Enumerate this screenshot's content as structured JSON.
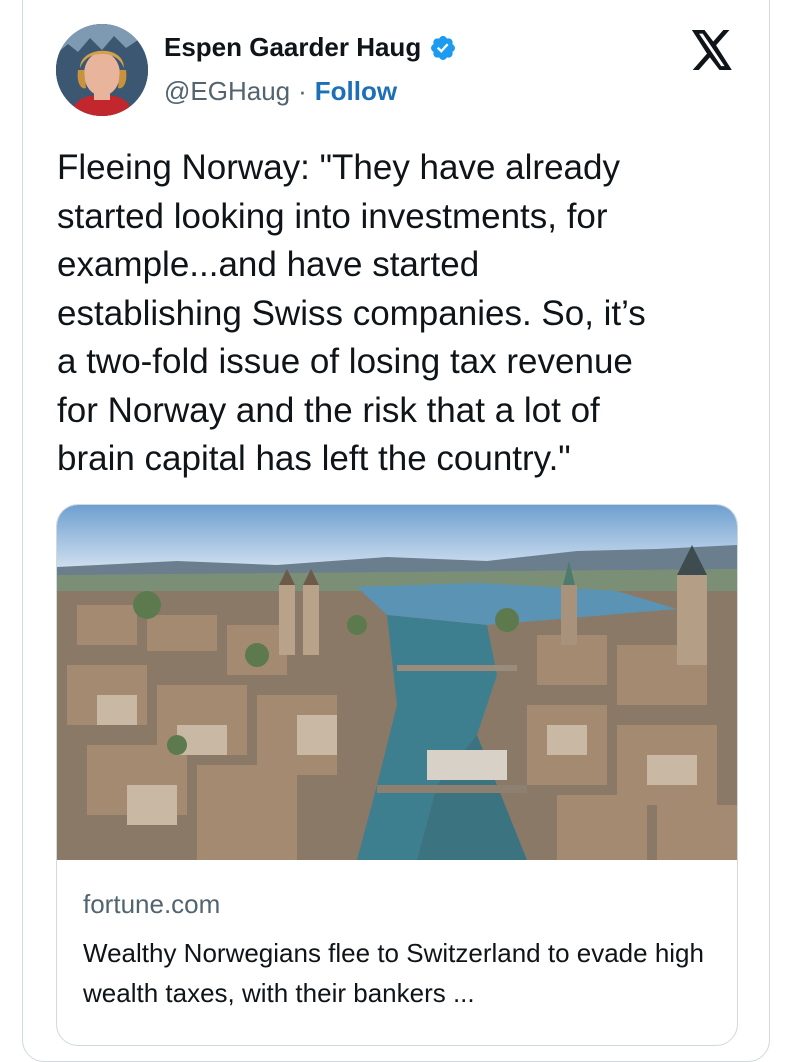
{
  "author": {
    "name": "Espen Gaarder Haug",
    "handle": "@EGHaug",
    "separator": "·",
    "follow_label": "Follow",
    "verified": true
  },
  "tweet": {
    "text": "Fleeing Norway: \"They have already\nstarted looking into investments, for\nexample...and have started\nestablishing Swiss companies. So, it’s\na two-fold issue of losing tax revenue\nfor Norway and the risk that a lot of\nbrain capital has left the country.\""
  },
  "link_card": {
    "domain": "fortune.com",
    "headline": "Wealthy Norwegians flee to Switzerland to evade high wealth taxes, with their bankers ..."
  },
  "icons": {
    "verified": "verified-badge-icon",
    "platform": "x-logo-icon"
  },
  "colors": {
    "verified_blue": "#1d9bf0",
    "follow_blue": "#1d6fb8",
    "muted": "#536471",
    "text": "#0f1419",
    "border": "#cfd9de"
  }
}
